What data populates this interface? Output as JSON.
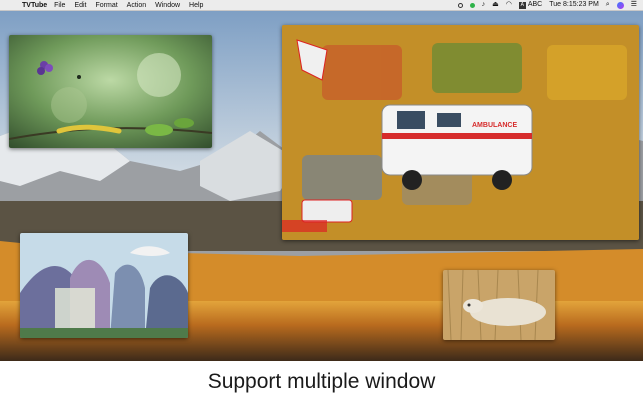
{
  "menubar": {
    "apple": "",
    "app_name": "TVTube",
    "menus": [
      "File",
      "Edit",
      "Format",
      "Action",
      "Window",
      "Help"
    ],
    "input_source": "ABC",
    "clock": "Tue 8:15:23 PM",
    "status_icons": [
      "circle-icon",
      "green-dot-icon",
      "speaker-icon",
      "eject-icon",
      "wifi-icon",
      "keyboard-input-icon",
      "clock",
      "search-icon",
      "siri-icon",
      "notification-list-icon"
    ]
  },
  "windows": [
    {
      "name": "caterpillar-video",
      "subject": "nature-clip"
    },
    {
      "name": "ambulance-video",
      "subject": "vehicles-clip"
    },
    {
      "name": "cartoon-landscape-video",
      "subject": "animation-clip"
    },
    {
      "name": "sheep-video",
      "subject": "animal-clip"
    }
  ],
  "ambulance_label": "AMBULANCE",
  "caption": "Support multiple window"
}
